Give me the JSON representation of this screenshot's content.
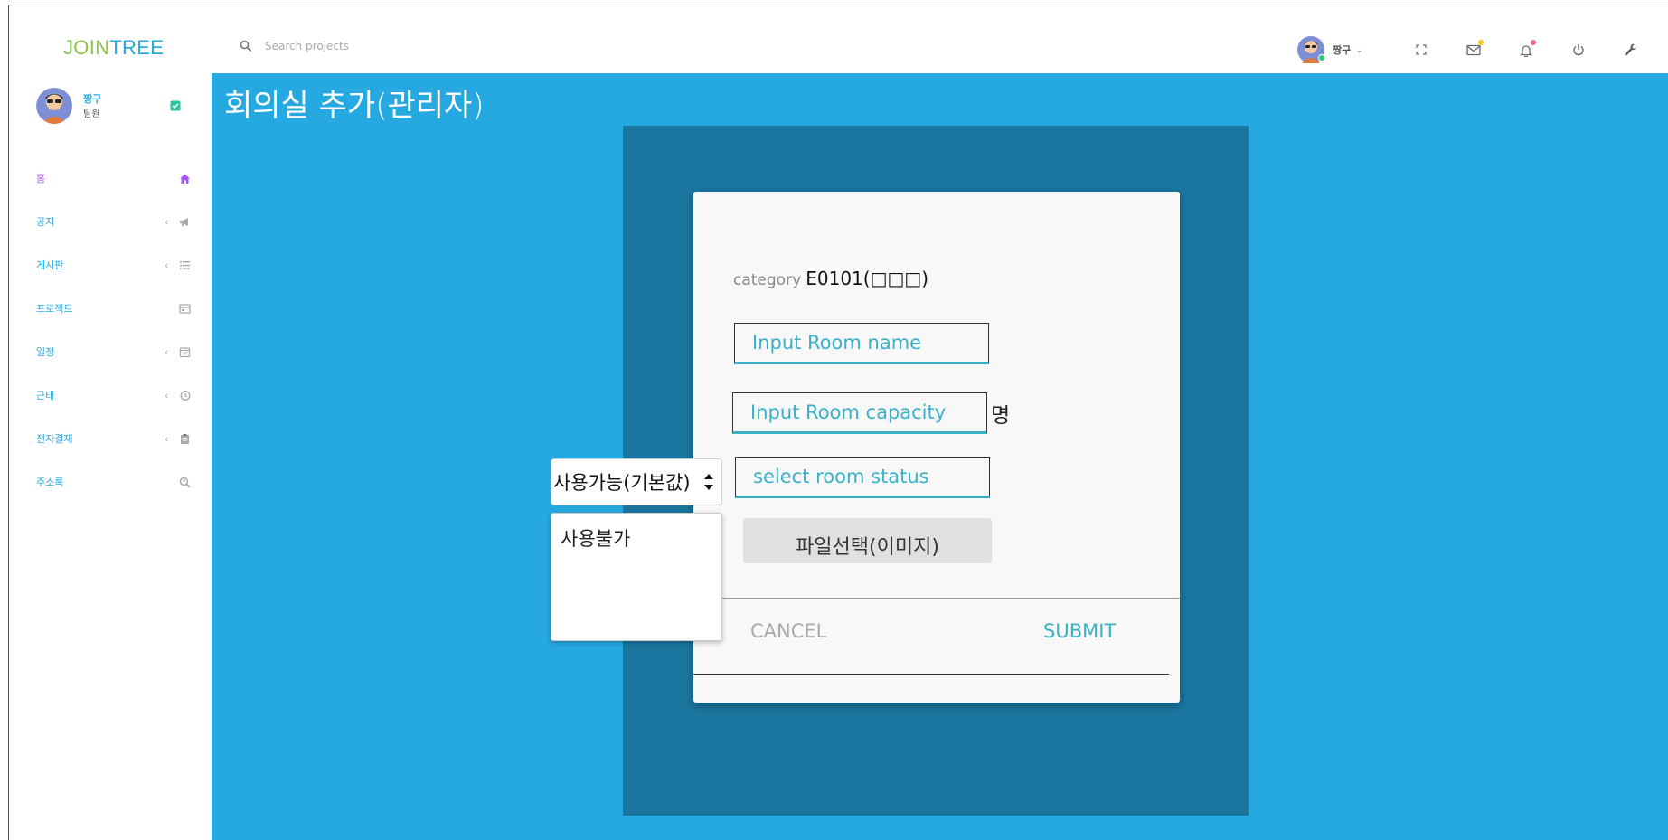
{
  "header": {
    "logo_part1": "JOIN",
    "logo_part2": "TREE",
    "search_placeholder": "Search projects",
    "user_name": "짱구",
    "icons": [
      "fullscreen-icon",
      "mail-icon",
      "bell-icon",
      "power-icon",
      "wrench-icon"
    ],
    "mail_badge_color": "#f5c518",
    "bell_badge_color": "#f06b8a"
  },
  "sidebar": {
    "user_name": "짱구",
    "user_role": "팀원",
    "items": [
      {
        "label": "홈",
        "icon": "home-icon",
        "has_chevron": false,
        "active": true
      },
      {
        "label": "공지",
        "icon": "megaphone-icon",
        "has_chevron": true
      },
      {
        "label": "게시판",
        "icon": "list-icon",
        "has_chevron": true
      },
      {
        "label": "프로젝트",
        "icon": "calendar-board-icon",
        "has_chevron": false
      },
      {
        "label": "일정",
        "icon": "calendar-check-icon",
        "has_chevron": true
      },
      {
        "label": "근태",
        "icon": "clock-history-icon",
        "has_chevron": true
      },
      {
        "label": "전자결재",
        "icon": "clipboard-icon",
        "has_chevron": true
      },
      {
        "label": "주소록",
        "icon": "search-person-icon",
        "has_chevron": false
      }
    ]
  },
  "main": {
    "page_title": "회의실 추가(관리자)",
    "form": {
      "category_label": "category",
      "category_value": "E0101(□□□)",
      "room_name_placeholder": "Input Room name",
      "room_capacity_placeholder": "Input Room capacity",
      "capacity_unit": "명",
      "room_status_placeholder": "select room status",
      "file_button": "파일선택(이미지)",
      "cancel": "CANCEL",
      "submit": "SUBMIT"
    },
    "status_select": {
      "selected": "사용가능(기본값)",
      "options": [
        "사용불가"
      ]
    }
  },
  "colors": {
    "main_bg": "#26a9e0",
    "panel_bg": "#1b769f",
    "accent": "#3ab1c9",
    "active_menu": "#a855f7"
  }
}
